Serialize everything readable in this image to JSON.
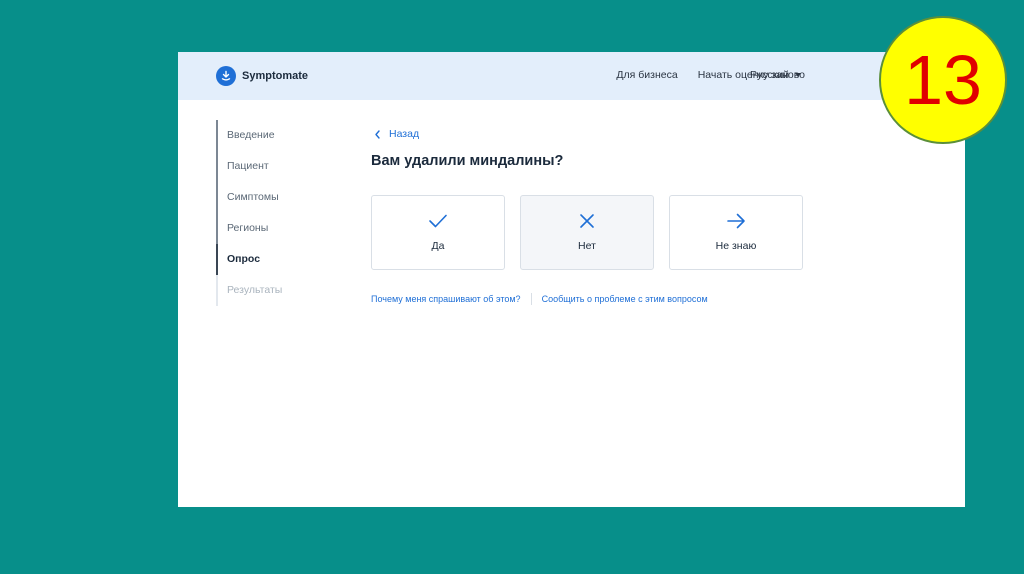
{
  "header": {
    "brand": "Symptomate",
    "nav": [
      "Для бизнеса",
      "Начать оценку заново"
    ],
    "language": "Русский"
  },
  "sidebar": {
    "steps": [
      {
        "label": "Введение",
        "state": "done"
      },
      {
        "label": "Пациент",
        "state": "done"
      },
      {
        "label": "Симптомы",
        "state": "done"
      },
      {
        "label": "Регионы",
        "state": "done"
      },
      {
        "label": "Опрос",
        "state": "active"
      },
      {
        "label": "Результаты",
        "state": "pending"
      }
    ]
  },
  "main": {
    "back_label": "Назад",
    "question": "Вам удалили миндалины?",
    "answers": [
      {
        "label": "Да",
        "icon": "check-icon"
      },
      {
        "label": "Нет",
        "icon": "cross-icon"
      },
      {
        "label": "Не знаю",
        "icon": "arrow-right-icon"
      }
    ],
    "links": [
      "Почему меня спрашивают об этом?",
      "Сообщить о проблеме с этим вопросом"
    ]
  },
  "slide_number": "13",
  "colors": {
    "accent": "#1f6fd6",
    "header_bg": "#e3eefb",
    "slide_bg": "#078f8a",
    "badge_bg": "#ffff00",
    "badge_text": "#e00000"
  }
}
